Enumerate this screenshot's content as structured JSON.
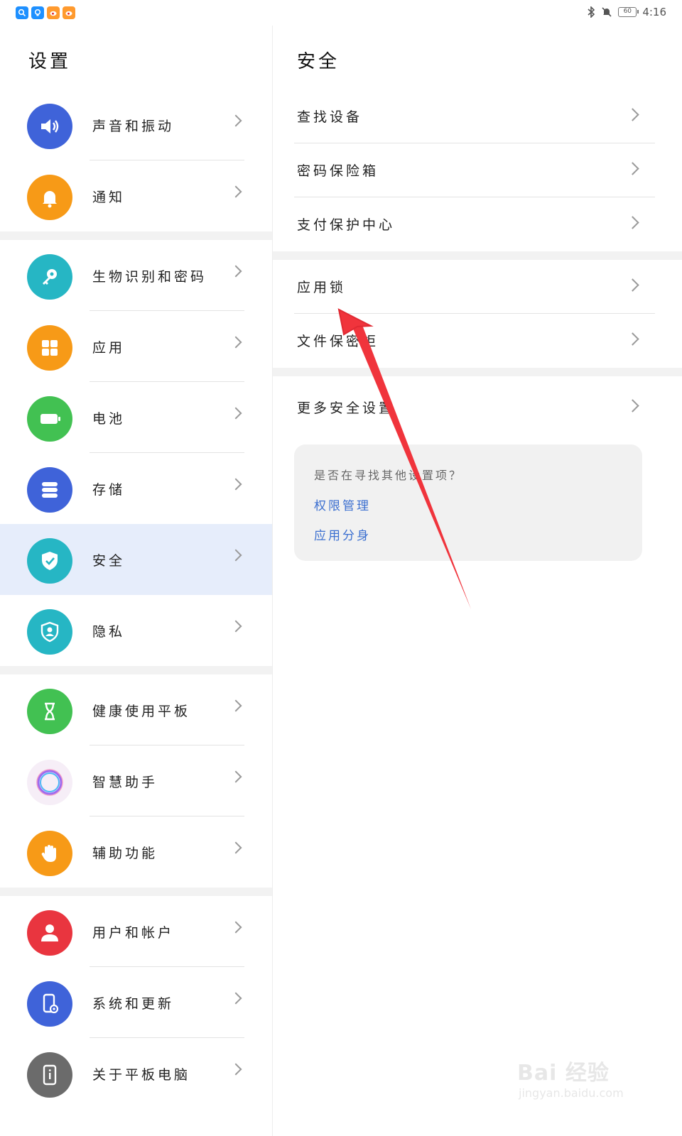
{
  "status_bar": {
    "time": "4:16",
    "battery": "60",
    "apps": [
      {
        "icon": "search-app-icon",
        "color": "#1e90ff"
      },
      {
        "icon": "bulb-app-icon",
        "color": "#1e90ff"
      },
      {
        "icon": "weibo-app-icon",
        "color": "#ff9a2e"
      },
      {
        "icon": "weibo-app-icon",
        "color": "#ff9a2e"
      }
    ]
  },
  "left": {
    "title": "设置",
    "items": [
      {
        "label": "声音和振动",
        "icon": "speaker-icon",
        "color": "#3f63d9"
      },
      {
        "label": "通知",
        "icon": "bell-icon",
        "color": "#f79a17"
      },
      {
        "label": "生物识别和密码",
        "icon": "key-icon",
        "color": "#26b6c4"
      },
      {
        "label": "应用",
        "icon": "apps-grid-icon",
        "color": "#f79a17"
      },
      {
        "label": "电池",
        "icon": "battery-icon",
        "color": "#42c152"
      },
      {
        "label": "存储",
        "icon": "storage-icon",
        "color": "#3f63d9"
      },
      {
        "label": "安全",
        "icon": "shield-check-icon",
        "color": "#26b6c4",
        "active": true
      },
      {
        "label": "隐私",
        "icon": "privacy-icon",
        "color": "#26b6c4"
      },
      {
        "label": "健康使用平板",
        "icon": "hourglass-icon",
        "color": "#42c152"
      },
      {
        "label": "智慧助手",
        "icon": "assistant-ring-icon",
        "color": "#ffffff"
      },
      {
        "label": "辅助功能",
        "icon": "hand-icon",
        "color": "#f79a17"
      },
      {
        "label": "用户和帐户",
        "icon": "user-icon",
        "color": "#e9353f"
      },
      {
        "label": "系统和更新",
        "icon": "system-update-icon",
        "color": "#3f63d9"
      },
      {
        "label": "关于平板电脑",
        "icon": "tablet-info-icon",
        "color": "#6b6b6b"
      }
    ]
  },
  "right": {
    "title": "安全",
    "group1": [
      "查找设备",
      "密码保险箱",
      "支付保护中心"
    ],
    "group2": [
      "应用锁",
      "文件保密柜"
    ],
    "group3": [
      "更多安全设置"
    ],
    "hint": {
      "question": "是否在寻找其他设置项？",
      "links": [
        "权限管理",
        "应用分身"
      ]
    }
  },
  "watermark": {
    "brand": "Bai 经验",
    "url": "jingyan.baidu.com"
  },
  "colors": {
    "active_row": "#e6edfb",
    "link": "#3b6fd0",
    "annotation_arrow": "#f0343c"
  }
}
